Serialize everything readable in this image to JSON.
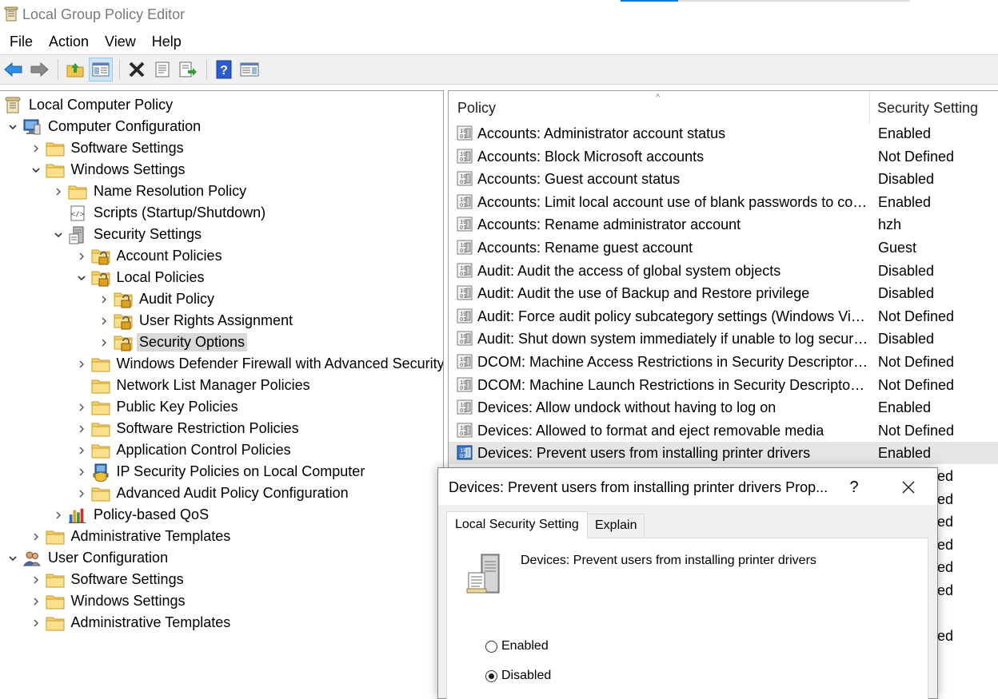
{
  "window": {
    "title": "Local Group Policy Editor"
  },
  "menu": [
    "File",
    "Action",
    "View",
    "Help"
  ],
  "toolbar": {
    "buttons": [
      "back-icon",
      "forward-icon",
      "up-folder-icon",
      "show-hide-tree-icon",
      "delete-icon",
      "properties-icon",
      "export-list-icon",
      "help-icon",
      "show-pane-icon"
    ]
  },
  "tree": [
    {
      "label": "Local Computer Policy",
      "icon": "policy-scroll-icon",
      "chevron": "none",
      "level": 0
    },
    {
      "label": "Computer Configuration",
      "icon": "computer-icon",
      "chevron": "expanded",
      "level": 1
    },
    {
      "label": "Software Settings",
      "icon": "folder-icon",
      "chevron": "collapsed",
      "level": 2
    },
    {
      "label": "Windows Settings",
      "icon": "folder-icon",
      "chevron": "expanded",
      "level": 2
    },
    {
      "label": "Name Resolution Policy",
      "icon": "folder-icon",
      "chevron": "collapsed",
      "level": 3
    },
    {
      "label": "Scripts (Startup/Shutdown)",
      "icon": "script-icon",
      "chevron": "none",
      "level": 3
    },
    {
      "label": "Security Settings",
      "icon": "security-settings-icon",
      "chevron": "expanded",
      "level": 3
    },
    {
      "label": "Account Policies",
      "icon": "locked-folder-icon",
      "chevron": "collapsed",
      "level": 4
    },
    {
      "label": "Local Policies",
      "icon": "locked-folder-icon",
      "chevron": "expanded",
      "level": 4
    },
    {
      "label": "Audit Policy",
      "icon": "locked-folder-icon",
      "chevron": "collapsed",
      "level": 5
    },
    {
      "label": "User Rights Assignment",
      "icon": "locked-folder-icon",
      "chevron": "collapsed",
      "level": 5
    },
    {
      "label": "Security Options",
      "icon": "locked-folder-icon",
      "chevron": "collapsed",
      "level": 5,
      "selected": true
    },
    {
      "label": "Windows Defender Firewall with Advanced Security",
      "icon": "folder-icon",
      "chevron": "collapsed",
      "level": 4
    },
    {
      "label": "Network List Manager Policies",
      "icon": "folder-icon",
      "chevron": "none",
      "level": 4
    },
    {
      "label": "Public Key Policies",
      "icon": "folder-icon",
      "chevron": "collapsed",
      "level": 4
    },
    {
      "label": "Software Restriction Policies",
      "icon": "folder-icon",
      "chevron": "collapsed",
      "level": 4
    },
    {
      "label": "Application Control Policies",
      "icon": "folder-icon",
      "chevron": "collapsed",
      "level": 4
    },
    {
      "label": "IP Security Policies on Local Computer",
      "icon": "ip-security-icon",
      "chevron": "collapsed",
      "level": 4
    },
    {
      "label": "Advanced Audit Policy Configuration",
      "icon": "folder-icon",
      "chevron": "collapsed",
      "level": 4
    },
    {
      "label": "Policy-based QoS",
      "icon": "qos-chart-icon",
      "chevron": "collapsed",
      "level": 3
    },
    {
      "label": "Administrative Templates",
      "icon": "folder-icon",
      "chevron": "collapsed",
      "level": 2
    },
    {
      "label": "User Configuration",
      "icon": "users-icon",
      "chevron": "expanded",
      "level": 1
    },
    {
      "label": "Software Settings",
      "icon": "folder-icon",
      "chevron": "collapsed",
      "level": 2
    },
    {
      "label": "Windows Settings",
      "icon": "folder-icon",
      "chevron": "collapsed",
      "level": 2
    },
    {
      "label": "Administrative Templates",
      "icon": "folder-icon",
      "chevron": "collapsed",
      "level": 2
    }
  ],
  "list": {
    "columns": {
      "policy": "Policy",
      "setting": "Security Setting"
    },
    "rows": [
      {
        "policy": "Accounts: Administrator account status",
        "setting": "Enabled"
      },
      {
        "policy": "Accounts: Block Microsoft accounts",
        "setting": "Not Defined"
      },
      {
        "policy": "Accounts: Guest account status",
        "setting": "Disabled"
      },
      {
        "policy": "Accounts: Limit local account use of blank passwords to console logon only",
        "setting": "Enabled"
      },
      {
        "policy": "Accounts: Rename administrator account",
        "setting": "hzh"
      },
      {
        "policy": "Accounts: Rename guest account",
        "setting": "Guest"
      },
      {
        "policy": "Audit: Audit the access of global system objects",
        "setting": "Disabled"
      },
      {
        "policy": "Audit: Audit the use of Backup and Restore privilege",
        "setting": "Disabled"
      },
      {
        "policy": "Audit: Force audit policy subcategory settings (Windows Vista or later) to override audit policy category settings",
        "setting": "Not Defined"
      },
      {
        "policy": "Audit: Shut down system immediately if unable to log security audits",
        "setting": "Disabled"
      },
      {
        "policy": "DCOM: Machine Access Restrictions in Security Descriptor Definition Language (SDDL) syntax",
        "setting": "Not Defined"
      },
      {
        "policy": "DCOM: Machine Launch Restrictions in Security Descriptor Definition Language (SDDL) syntax",
        "setting": "Not Defined"
      },
      {
        "policy": "Devices: Allow undock without having to log on",
        "setting": "Enabled"
      },
      {
        "policy": "Devices: Allowed to format and eject removable media",
        "setting": "Not Defined"
      },
      {
        "policy": "Devices: Prevent users from installing printer drivers",
        "setting": "Enabled",
        "selected": true
      }
    ],
    "partial_settings": [
      "ed",
      "ed",
      "ed",
      "ed",
      "ed",
      "ed",
      "",
      "ed"
    ]
  },
  "dialog": {
    "title": "Devices: Prevent users from installing printer drivers Prop...",
    "help": "?",
    "tabs": {
      "active": "Local Security Setting",
      "inactive": "Explain"
    },
    "policy_name": "Devices: Prevent users from installing printer drivers",
    "options": {
      "enabled": "Enabled",
      "disabled": "Disabled"
    },
    "selected_option": "disabled"
  }
}
